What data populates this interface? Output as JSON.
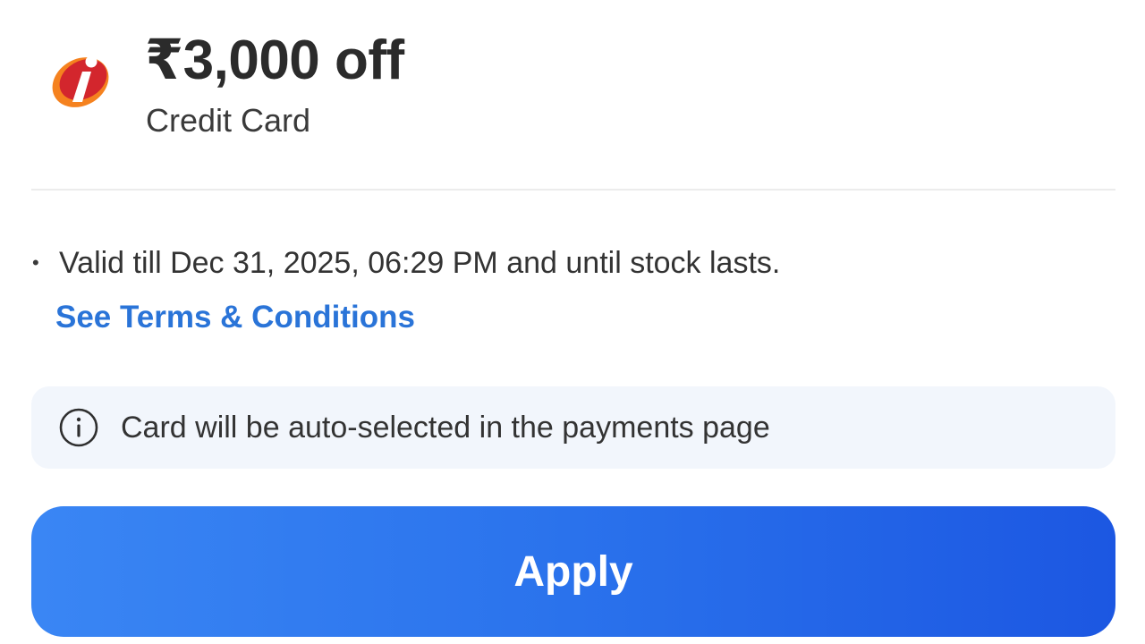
{
  "offer": {
    "amount": "₹3,000 off",
    "card_type": "Credit Card",
    "logo": {
      "icon": "bank-logo-icon",
      "colors": {
        "primary": "#c8282d",
        "accent": "#f5821f"
      }
    }
  },
  "details": {
    "bullet": "•",
    "validity": "Valid till Dec 31, 2025, 06:29 PM and until stock lasts.",
    "terms_link": "See Terms & Conditions"
  },
  "info_banner": {
    "icon": "info-icon",
    "text": "Card will be auto-selected in the payments page"
  },
  "apply_button": {
    "label": "Apply"
  },
  "colors": {
    "link": "#2a74d8",
    "button_start": "#3a86f4",
    "button_end": "#1c57e2",
    "banner_bg": "#f2f6fc"
  }
}
